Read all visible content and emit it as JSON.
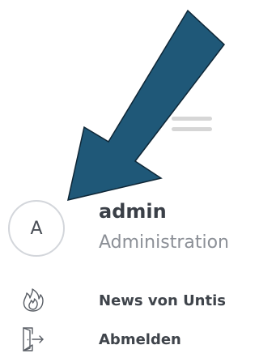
{
  "header": {
    "menu_icon": "hamburger-icon"
  },
  "user": {
    "avatar_initial": "A",
    "name": "admin",
    "role": "Administration"
  },
  "menu": {
    "items": [
      {
        "label": "News von Untis",
        "icon": "flame-icon"
      },
      {
        "label": "Abmelden",
        "icon": "logout-door-icon"
      }
    ]
  },
  "annotation": {
    "arrow_color": "#1f5878",
    "arrow_outline": "#0e2636"
  }
}
